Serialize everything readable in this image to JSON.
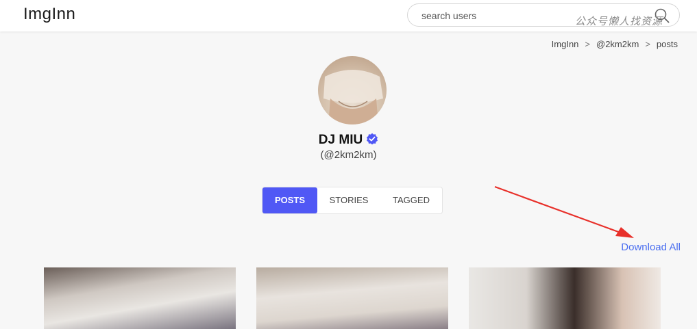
{
  "header": {
    "logo": "ImgInn",
    "search_placeholder": "search users",
    "watermark": "公众号懒人找资源"
  },
  "breadcrumb": [
    "ImgInn",
    "@2km2km",
    "posts"
  ],
  "profile": {
    "display_name": "DJ MIU",
    "handle": "(@2km2km)",
    "verified_color": "#5058f5"
  },
  "tabs": [
    {
      "label": "POSTS",
      "active": true
    },
    {
      "label": "STORIES",
      "active": false
    },
    {
      "label": "TAGGED",
      "active": false
    }
  ],
  "download_all": "Download All",
  "colors": {
    "accent": "#5058f5",
    "link": "#4a6ef0",
    "annotation_arrow": "#e8302a"
  },
  "posts_count_visible": 3
}
